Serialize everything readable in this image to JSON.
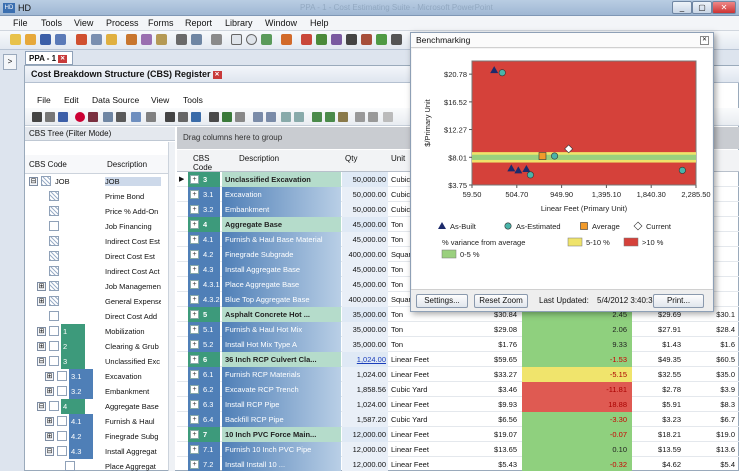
{
  "app": {
    "title": "HD",
    "window_text": "PPA - 1 - Cost Estimating Suite - Microsoft PowerPoint"
  },
  "menu": [
    "File",
    "Tools",
    "View",
    "Process",
    "Forms",
    "Report",
    "Library",
    "Window",
    "Help"
  ],
  "side_tab": ">",
  "doc_tab": "PPA - 1",
  "panel_title": "Cost Breakdown Structure (CBS) Register",
  "inner_menu": [
    "File",
    "Edit",
    "Data Source",
    "View",
    "Tools"
  ],
  "tree": {
    "header": "CBS Tree (Filter Mode)",
    "col_code": "CBS Code",
    "col_desc": "Description",
    "rows": [
      {
        "toggle": "⊟",
        "code": "JOB",
        "code_style": "",
        "desc": "JOB",
        "indent": 0,
        "icon": "dots"
      },
      {
        "toggle": "",
        "code": "",
        "code_style": "",
        "desc": "Prime Bond",
        "indent": 1,
        "icon": "dots"
      },
      {
        "toggle": "",
        "code": "",
        "code_style": "",
        "desc": "Price % Add-On",
        "indent": 1,
        "icon": "dots"
      },
      {
        "toggle": "",
        "code": "",
        "code_style": "",
        "desc": "Job Financing",
        "indent": 1,
        "icon": "plain"
      },
      {
        "toggle": "",
        "code": "",
        "code_style": "",
        "desc": "Indirect Cost Est",
        "indent": 1,
        "icon": "dots"
      },
      {
        "toggle": "",
        "code": "",
        "code_style": "",
        "desc": "Direct Cost Est",
        "indent": 1,
        "icon": "dots"
      },
      {
        "toggle": "",
        "code": "",
        "code_style": "",
        "desc": "Indirect Cost Act",
        "indent": 1,
        "icon": "dots"
      },
      {
        "toggle": "⊞",
        "code": "",
        "code_style": "",
        "desc": "Job Management",
        "indent": 1,
        "icon": "dots"
      },
      {
        "toggle": "⊞",
        "code": "",
        "code_style": "",
        "desc": "General Expense",
        "indent": 1,
        "icon": "dots"
      },
      {
        "toggle": "",
        "code": "",
        "code_style": "",
        "desc": "Direct Cost Add",
        "indent": 1,
        "icon": "plain"
      },
      {
        "toggle": "⊞",
        "code": "1",
        "code_style": "green",
        "desc": "Mobilization",
        "indent": 1,
        "icon": "plain"
      },
      {
        "toggle": "⊞",
        "code": "2",
        "code_style": "green",
        "desc": "Clearing & Grub",
        "indent": 1,
        "icon": "plain"
      },
      {
        "toggle": "⊟",
        "code": "3",
        "code_style": "green",
        "desc": "Unclassified Exc",
        "indent": 1,
        "icon": "plain"
      },
      {
        "toggle": "⊞",
        "code": "3.1",
        "code_style": "blue",
        "desc": "Excavation",
        "indent": 2,
        "icon": "plain"
      },
      {
        "toggle": "⊞",
        "code": "3.2",
        "code_style": "blue",
        "desc": "Embankment",
        "indent": 2,
        "icon": "plain"
      },
      {
        "toggle": "⊟",
        "code": "4",
        "code_style": "green",
        "desc": "Aggregate Base",
        "indent": 1,
        "icon": "plain"
      },
      {
        "toggle": "⊞",
        "code": "4.1",
        "code_style": "blue",
        "desc": "Furnish & Haul",
        "indent": 2,
        "icon": "plain"
      },
      {
        "toggle": "⊞",
        "code": "4.2",
        "code_style": "blue",
        "desc": "Finegrade Subg",
        "indent": 2,
        "icon": "plain"
      },
      {
        "toggle": "⊟",
        "code": "4.3",
        "code_style": "blue",
        "desc": "Install Aggregat",
        "indent": 2,
        "icon": "plain"
      },
      {
        "toggle": "",
        "code": "",
        "code_style": "",
        "desc": "Place Aggregat",
        "indent": 3,
        "icon": "plain"
      }
    ]
  },
  "grid": {
    "group_hint": "Drag columns here to group",
    "columns": {
      "code": "CBS Code",
      "desc": "Description",
      "qty": "Qty",
      "unit": "Unit"
    },
    "rows": [
      {
        "code": "3",
        "desc": "Unclassified Excavation",
        "qty": "50,000.00",
        "unit": "Cubic Yard",
        "level": 1,
        "c1": "",
        "var": "",
        "varcolor": "",
        "c3": "",
        "c4": "",
        "current": true
      },
      {
        "code": "3.1",
        "desc": "Excavation",
        "qty": "50,000.00",
        "unit": "Cubic Yard",
        "level": 2,
        "c1": "",
        "var": "",
        "varcolor": "",
        "c3": "",
        "c4": ""
      },
      {
        "code": "3.2",
        "desc": "Embankment",
        "qty": "50,000.00",
        "unit": "Cubic Yard",
        "level": 2,
        "c1": "",
        "var": "",
        "varcolor": "",
        "c3": "",
        "c4": ""
      },
      {
        "code": "4",
        "desc": "Aggregate Base",
        "qty": "45,000.00",
        "unit": "Ton",
        "level": 1,
        "c1": "",
        "var": "",
        "varcolor": "",
        "c3": "",
        "c4": ""
      },
      {
        "code": "4.1",
        "desc": "Furnish & Haul Base Material",
        "qty": "45,000.00",
        "unit": "Ton",
        "level": 2,
        "c1": "",
        "var": "",
        "varcolor": "",
        "c3": "",
        "c4": ""
      },
      {
        "code": "4.2",
        "desc": "Finegrade Subgrade",
        "qty": "400,000.00",
        "unit": "Square Yard",
        "level": 2,
        "c1": "",
        "var": "",
        "varcolor": "",
        "c3": "",
        "c4": ""
      },
      {
        "code": "4.3",
        "desc": "Install Aggregate Base",
        "qty": "45,000.00",
        "unit": "Ton",
        "level": 2,
        "c1": "",
        "var": "",
        "varcolor": "",
        "c3": "",
        "c4": ""
      },
      {
        "code": "4.3.1",
        "desc": "Place Aggregate Base",
        "qty": "45,000.00",
        "unit": "Ton",
        "level": 3,
        "c1": "",
        "var": "",
        "varcolor": "",
        "c3": "",
        "c4": ""
      },
      {
        "code": "4.3.2",
        "desc": "Blue Top Aggregate Base",
        "qty": "400,000.00",
        "unit": "Square Yard",
        "level": 3,
        "c1": "",
        "var": "",
        "varcolor": "",
        "c3": "",
        "c4": ""
      },
      {
        "code": "5",
        "desc": "Asphalt Concrete Hot ...",
        "qty": "35,000.00",
        "unit": "Ton",
        "level": 1,
        "c1": "$30.84",
        "var": "2.45",
        "varcolor": "green",
        "c3": "$29.69",
        "c4": "$30.1"
      },
      {
        "code": "5.1",
        "desc": "Furnish & Haul Hot Mix",
        "qty": "35,000.00",
        "unit": "Ton",
        "level": 2,
        "c1": "$29.08",
        "var": "2.06",
        "varcolor": "green",
        "c3": "$27.91",
        "c4": "$28.4"
      },
      {
        "code": "5.2",
        "desc": "Install Hot Mix Type A",
        "qty": "35,000.00",
        "unit": "Ton",
        "level": 2,
        "c1": "$1.76",
        "var": "9.33",
        "varcolor": "green",
        "c3": "$1.43",
        "c4": "$1.6"
      },
      {
        "code": "6",
        "desc": "36 Inch RCP Culvert Cla...",
        "qty": "1,024.00",
        "unit": "Linear Feet",
        "level": 1,
        "c1": "$59.65",
        "var": "-1.53",
        "varcolor": "green",
        "c3": "$49.35",
        "c4": "$60.5",
        "link": true
      },
      {
        "code": "6.1",
        "desc": "Furnish RCP Materials",
        "qty": "1,024.00",
        "unit": "Linear Feet",
        "level": 2,
        "c1": "$33.27",
        "var": "-5.15",
        "varcolor": "yellow",
        "c3": "$32.55",
        "c4": "$35.0"
      },
      {
        "code": "6.2",
        "desc": "Excavate RCP Trench",
        "qty": "1,858.56",
        "unit": "Cubic Yard",
        "level": 2,
        "c1": "$3.46",
        "var": "-11.81",
        "varcolor": "red",
        "c3": "$2.78",
        "c4": "$3.9"
      },
      {
        "code": "6.3",
        "desc": "Install RCP Pipe",
        "qty": "1,024.00",
        "unit": "Linear Feet",
        "level": 2,
        "c1": "$9.93",
        "var": "18.88",
        "varcolor": "red",
        "c3": "$5.91",
        "c4": "$8.3"
      },
      {
        "code": "6.4",
        "desc": "Backfill RCP Pipe",
        "qty": "1,587.20",
        "unit": "Cubic Yard",
        "level": 2,
        "c1": "$6.56",
        "var": "-3.30",
        "varcolor": "green",
        "c3": "$3.23",
        "c4": "$6.7"
      },
      {
        "code": "7",
        "desc": "10 Inch PVC Force Main...",
        "qty": "12,000.00",
        "unit": "Linear Feet",
        "level": 1,
        "c1": "$19.07",
        "var": "-0.07",
        "varcolor": "green",
        "c3": "$18.21",
        "c4": "$19.0"
      },
      {
        "code": "7.1",
        "desc": "Furnish 10 Inch PVC Pipe",
        "qty": "12,000.00",
        "unit": "Linear Feet",
        "level": 2,
        "c1": "$13.65",
        "var": "0.10",
        "varcolor": "green",
        "c3": "$13.59",
        "c4": "$13.6"
      },
      {
        "code": "7.2",
        "desc": "Install Install 10 ...",
        "qty": "12,000.00",
        "unit": "Linear Feet",
        "level": 2,
        "c1": "$5.43",
        "var": "-0.32",
        "varcolor": "green",
        "c3": "$4.62",
        "c4": "$5.4"
      }
    ]
  },
  "benchmark": {
    "title": "Benchmarking",
    "settings_label": "Settings...",
    "reset_label": "Reset Zoom",
    "updated_label": "Last Updated:",
    "updated_value": "5/4/2012 3:40:3",
    "print_label": "Print...",
    "legend": {
      "as_built": "As-Built",
      "as_estimated": "As-Estimated",
      "average": "Average",
      "current": "Current",
      "variance": "% variance from average",
      "band1": "0-5 %",
      "band2": "5-10 %",
      "band3": ">10 %"
    },
    "colors": {
      "red": "#d5413a",
      "yellow": "#efe36a",
      "green": "#9ad07e",
      "teal": "#49b4a9",
      "navy": "#1c2a6b",
      "orange": "#f19a2a"
    }
  },
  "chart_data": {
    "type": "scatter",
    "title": "",
    "xlabel": "Linear Feet (Primary Unit)",
    "ylabel": "$/Primary Unit",
    "xlim": [
      59.5,
      2285.5
    ],
    "ylim": [
      3.75,
      22.8
    ],
    "x_ticks": [
      "59.50",
      "504.70",
      "949.90",
      "1,395.10",
      "1,840.30",
      "2,285.50"
    ],
    "y_ticks": [
      "$3.75",
      "$8.01",
      "$12.27",
      "$16.52",
      "$20.78"
    ],
    "bands": {
      "average": 8.01,
      "band_green": [
        7.6,
        8.4
      ],
      "band_yellow": [
        7.2,
        8.8
      ]
    },
    "series": [
      {
        "name": "As-Built",
        "marker": "triangle",
        "color": "#1c2a6b",
        "points": [
          [
            280,
            21.4
          ],
          [
            450,
            6.3
          ],
          [
            520,
            6.0
          ],
          [
            600,
            6.2
          ]
        ]
      },
      {
        "name": "As-Estimated",
        "marker": "circle",
        "color": "#49b4a9",
        "points": [
          [
            360,
            21.0
          ],
          [
            880,
            8.2
          ],
          [
            640,
            5.3
          ],
          [
            2150,
            6.0
          ]
        ]
      },
      {
        "name": "Average",
        "marker": "square",
        "color": "#f19a2a",
        "points": [
          [
            760,
            8.2
          ]
        ]
      },
      {
        "name": "Current",
        "marker": "diamond",
        "color": "#ffffff",
        "points": [
          [
            1020,
            9.3
          ]
        ]
      }
    ]
  }
}
